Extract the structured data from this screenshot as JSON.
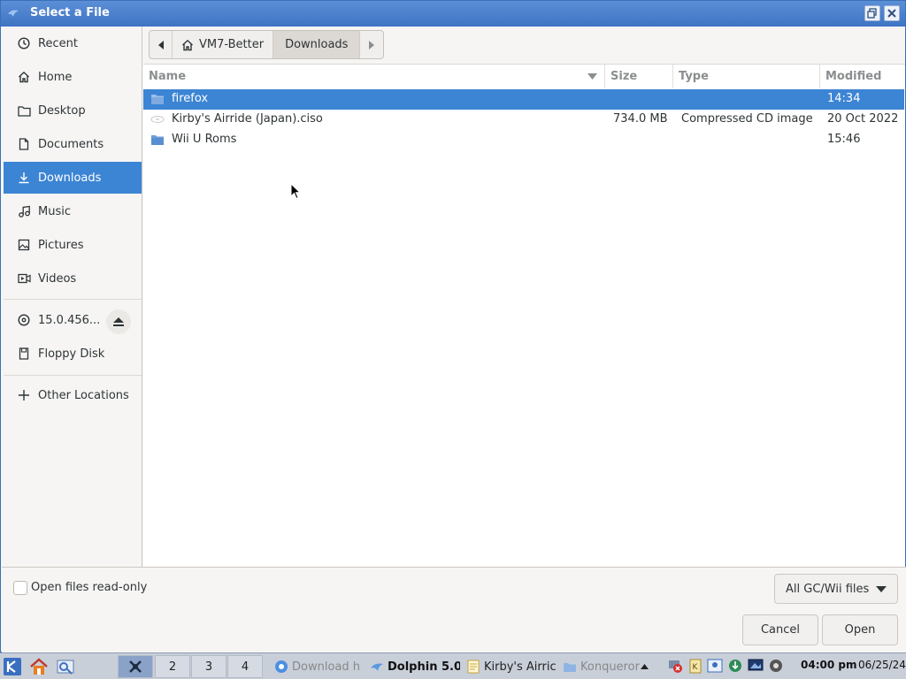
{
  "window": {
    "title": "Select a File"
  },
  "sidebar": {
    "places": [
      {
        "label": "Recent",
        "icon": "clock-icon"
      },
      {
        "label": "Home",
        "icon": "home-icon"
      },
      {
        "label": "Desktop",
        "icon": "folder-icon"
      },
      {
        "label": "Documents",
        "icon": "document-icon"
      },
      {
        "label": "Downloads",
        "icon": "download-icon",
        "active": true
      },
      {
        "label": "Music",
        "icon": "music-icon"
      },
      {
        "label": "Pictures",
        "icon": "picture-icon"
      },
      {
        "label": "Videos",
        "icon": "video-icon"
      }
    ],
    "devices": [
      {
        "label": "15.0.456...",
        "icon": "disc-icon"
      },
      {
        "label": "Floppy Disk",
        "icon": "floppy-icon"
      }
    ],
    "other_locations": "Other Locations"
  },
  "pathbar": {
    "home_label": "VM7-Better",
    "current_label": "Downloads"
  },
  "filelist": {
    "columns": {
      "name": "Name",
      "size": "Size",
      "type": "Type",
      "modified": "Modified"
    },
    "rows": [
      {
        "name": "firefox",
        "size": "",
        "type": "",
        "modified": "14:34",
        "icon": "folder-icon",
        "selected": true
      },
      {
        "name": "Kirby's Airride (Japan).ciso",
        "size": "734.0 MB",
        "type": "Compressed CD image",
        "modified": "20 Oct 2022",
        "icon": "disc-image-icon"
      },
      {
        "name": "Wii U Roms",
        "size": "",
        "type": "",
        "modified": "15:46",
        "icon": "folder-icon"
      }
    ]
  },
  "bottom": {
    "readonly_label": "Open files read-only",
    "filter_label": "All GC/Wii files",
    "cancel_label": "Cancel",
    "open_label": "Open"
  },
  "taskbar": {
    "desktops": [
      "2",
      "3",
      "4"
    ],
    "tasks": [
      {
        "label": "Download h",
        "icon": "chrome-icon"
      },
      {
        "label": "Dolphin 5.0",
        "icon": "dolphin-icon",
        "bold": true
      },
      {
        "label": "Kirby's Airric",
        "icon": "document-icon"
      },
      {
        "label": "Konqueror",
        "icon": "folder-icon"
      }
    ],
    "time": "04:00 pm",
    "date": "06/25/24"
  },
  "colors": {
    "accent": "#3c84d4",
    "titlebar": "#4a80cc"
  }
}
